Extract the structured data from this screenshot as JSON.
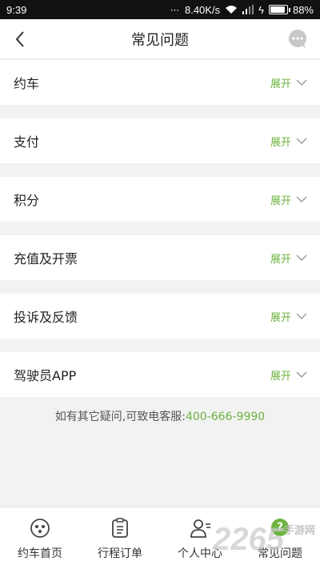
{
  "status_bar": {
    "time": "9:39",
    "network_speed": "8.40K/s",
    "battery": "88%",
    "battery_level": 0.88
  },
  "header": {
    "title": "常见问题",
    "back_icon": "chevron-left-icon",
    "chat_icon": "chat-bubble-icon"
  },
  "faq": {
    "expand_label": "展开",
    "items": [
      {
        "label": "约车"
      },
      {
        "label": "支付"
      },
      {
        "label": "积分"
      },
      {
        "label": "充值及开票"
      },
      {
        "label": "投诉及反馈"
      },
      {
        "label": "驾驶员APP"
      }
    ]
  },
  "help": {
    "text": "如有其它疑问,可致电客服:",
    "phone": "400-666-9990"
  },
  "bottom_nav": {
    "items": [
      {
        "label": "约车首页",
        "icon": "car-home-icon"
      },
      {
        "label": "行程订单",
        "icon": "clipboard-icon"
      },
      {
        "label": "个人中心",
        "icon": "user-icon"
      },
      {
        "label": "常见问题",
        "icon": "question-icon"
      }
    ],
    "active_index": 3
  },
  "watermark": {
    "text": "2265",
    "sub": "手游网"
  },
  "colors": {
    "accent": "#6db33f"
  }
}
